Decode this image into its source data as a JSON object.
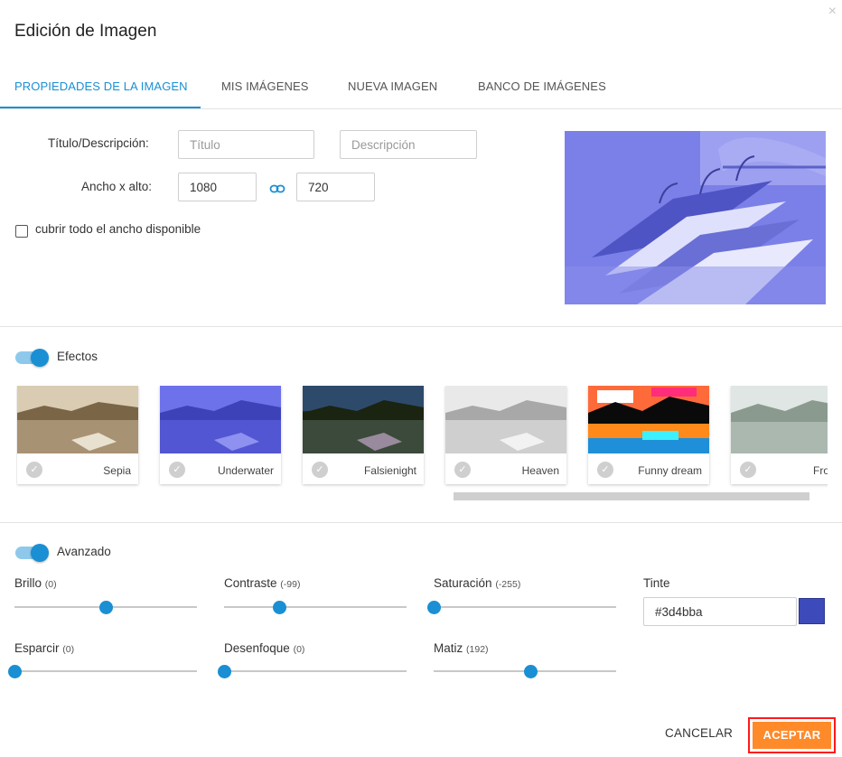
{
  "dialog": {
    "title": "Edición de Imagen",
    "close_icon": "×"
  },
  "tabs": [
    {
      "label": "PROPIEDADES DE LA IMAGEN",
      "active": true
    },
    {
      "label": "MIS IMÁGENES",
      "active": false
    },
    {
      "label": "NUEVA IMAGEN",
      "active": false
    },
    {
      "label": "BANCO DE IMÁGENES",
      "active": false
    }
  ],
  "properties": {
    "title_label": "Título/Descripción:",
    "title_placeholder": "Título",
    "description_placeholder": "Descripción",
    "size_label": "Ancho x alto:",
    "width": "1080",
    "height": "720",
    "link_icon": "link-icon",
    "cover_label": "cubrir todo el ancho disponible",
    "cover_checked": false
  },
  "effects": {
    "label": "Efectos",
    "enabled": true,
    "items": [
      {
        "name": "Sepia",
        "selected": false
      },
      {
        "name": "Underwater",
        "selected": false
      },
      {
        "name": "Falsienight",
        "selected": false
      },
      {
        "name": "Heaven",
        "selected": false
      },
      {
        "name": "Funny dream",
        "selected": false
      },
      {
        "name": "Fro",
        "selected": false
      }
    ]
  },
  "advanced": {
    "label": "Avanzado",
    "enabled": true,
    "sliders": [
      {
        "label": "Brillo",
        "value": "(0)",
        "fraction": 0.5
      },
      {
        "label": "Contraste",
        "value": "(-99)",
        "fraction": 0.3
      },
      {
        "label": "Saturación",
        "value": "(-255)",
        "fraction": 0.0
      },
      {
        "label": "Esparcir",
        "value": "(0)",
        "fraction": 0.0
      },
      {
        "label": "Desenfoque",
        "value": "(0)",
        "fraction": 0.0
      },
      {
        "label": "Matiz",
        "value": "(192)",
        "fraction": 0.53
      }
    ],
    "tint_label": "Tinte",
    "tint_value": "#3d4bba",
    "tint_color": "#3d4bba"
  },
  "footer": {
    "cancel_label": "CANCELAR",
    "accept_label": "ACEPTAR"
  },
  "colors": {
    "accent": "#1a8fd3",
    "accept": "#ff8a2a",
    "highlight_border": "#ff1a1a",
    "preview_tint": "#7a80e6"
  }
}
